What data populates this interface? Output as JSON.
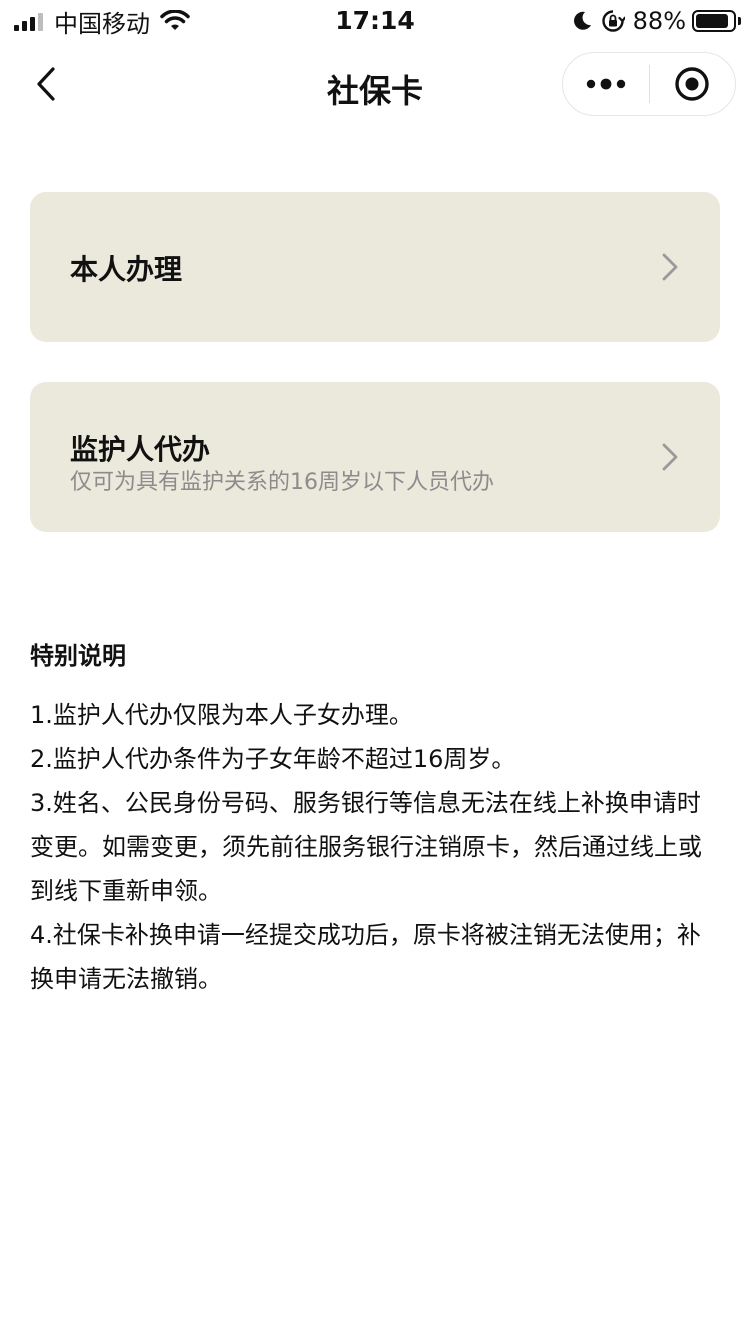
{
  "status_bar": {
    "carrier": "中国移动",
    "time": "17:14",
    "battery": "88%",
    "battery_level": 0.88,
    "icons": [
      "signal-icon",
      "wifi-icon",
      "moon-icon",
      "rotation-lock-icon",
      "battery-icon"
    ]
  },
  "nav": {
    "title": "社保卡",
    "icons": [
      "back-chevron-icon",
      "more-dots-icon",
      "close-target-icon"
    ]
  },
  "options": [
    {
      "title": "本人办理",
      "subtitle": ""
    },
    {
      "title": "监护人代办",
      "subtitle": "仅可为具有监护关系的16周岁以下人员代办"
    }
  ],
  "notes": {
    "title": "特别说明",
    "items": [
      "1.监护人代办仅限为本人子女办理。",
      "2.监护人代办条件为子女年龄不超过16周岁。",
      "3.姓名、公民身份号码、服务银行等信息无法在线上补换申请时变更。如需变更，须先前往服务银行注销原卡，然后通过线上或到线下重新申领。",
      "4.社保卡补换申请一经提交成功后，原卡将被注销无法使用；补换申请无法撤销。"
    ]
  },
  "colors": {
    "card_bg": "#ebe8dc",
    "subtitle_text": "#8c8c8c",
    "primary_text": "#111111",
    "chevron": "#9a9a9a"
  }
}
